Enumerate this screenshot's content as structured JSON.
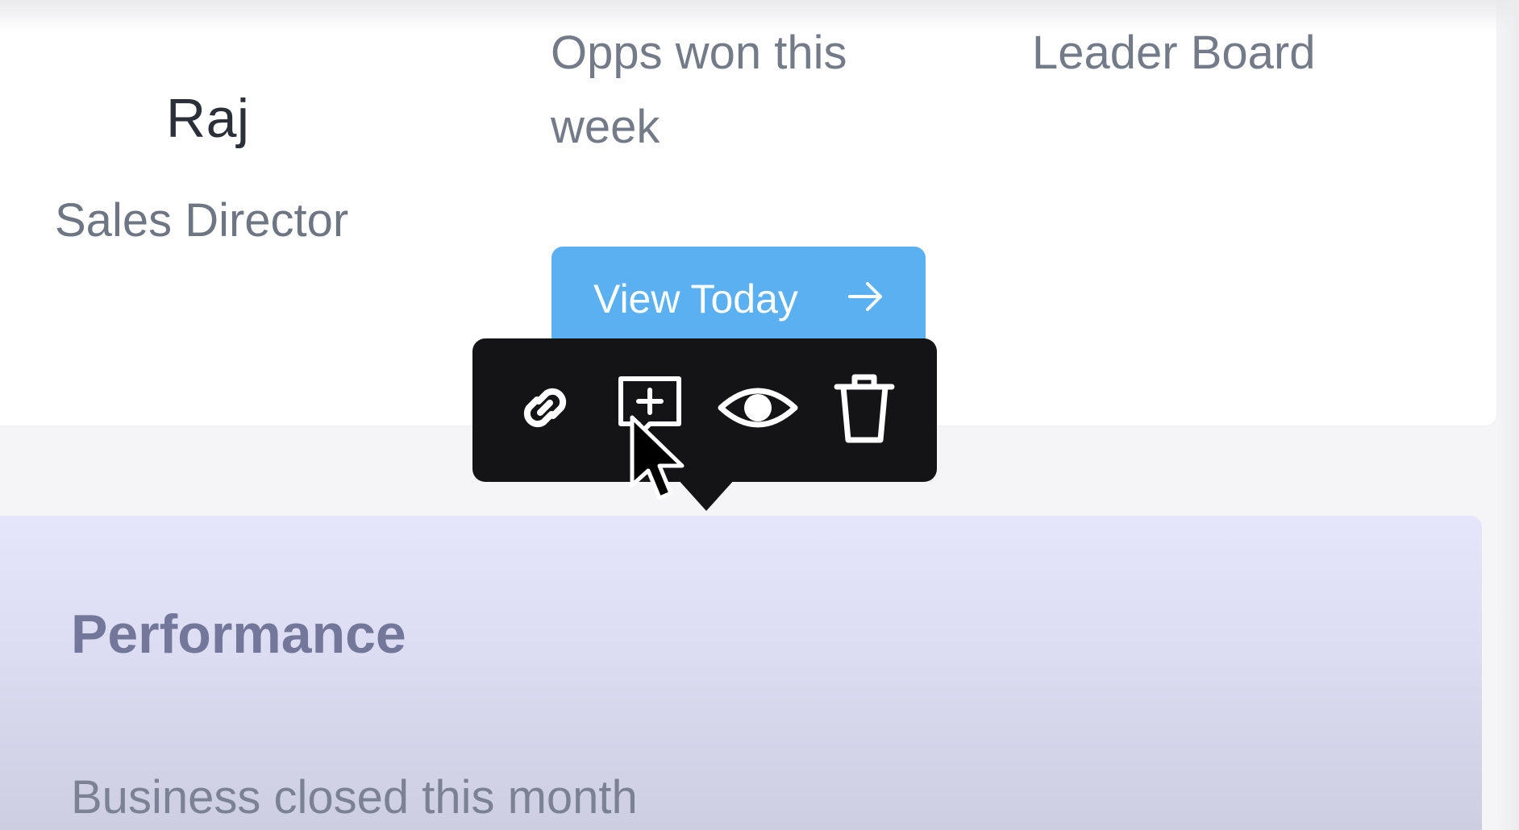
{
  "profile": {
    "name": "Raj",
    "role": "Sales Director"
  },
  "stats": {
    "opps_label_line1": "Opps won this",
    "opps_label_line2": "week",
    "leaderboard_label": "Leader Board"
  },
  "view_button": {
    "label": "View Today",
    "icon": "arrow-right-icon"
  },
  "toolbar": {
    "items": [
      {
        "icon": "link-icon"
      },
      {
        "icon": "add-comment-icon"
      },
      {
        "icon": "eye-icon"
      },
      {
        "icon": "trash-icon"
      }
    ]
  },
  "performance": {
    "title": "Performance",
    "subtitle": "Business closed this month"
  },
  "colors": {
    "button": "#5ab0f0",
    "toolbar": "#141416",
    "performance_bg": "#e5e5fb"
  }
}
